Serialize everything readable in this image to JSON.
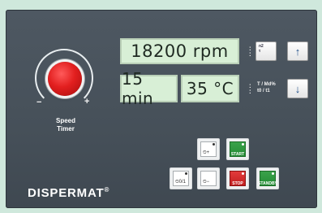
{
  "knob": {
    "label_line1": "Speed",
    "label_line2": "Timer",
    "minus": "−",
    "plus": "+"
  },
  "displays": {
    "speed": "18200 rpm",
    "time": "15 min",
    "temperature": "35 °C"
  },
  "side_labels": {
    "speed_mode": "n2\nτ",
    "info_line1": "T / Md%",
    "info_line2": "t0 / t1"
  },
  "arrows": {
    "up": "↑",
    "down": "↓"
  },
  "keys": {
    "timer_plus": {
      "glyph": "⏲+"
    },
    "start": {
      "label": "START"
    },
    "timer_io": {
      "glyph": "⏲0/1"
    },
    "timer_minus": {
      "glyph": "⏲−"
    },
    "stop": {
      "label": "STOP"
    },
    "standby": {
      "label": "STANDBY"
    }
  },
  "brand": {
    "name": "DISPERMAT",
    "mark": "®"
  },
  "colors": {
    "panel": "#4b555e",
    "background": "#cfe8dc",
    "lcd": "#d8efd6",
    "start": "#2e9a40",
    "stop": "#d22a2a",
    "knob": "#e21f1f"
  }
}
